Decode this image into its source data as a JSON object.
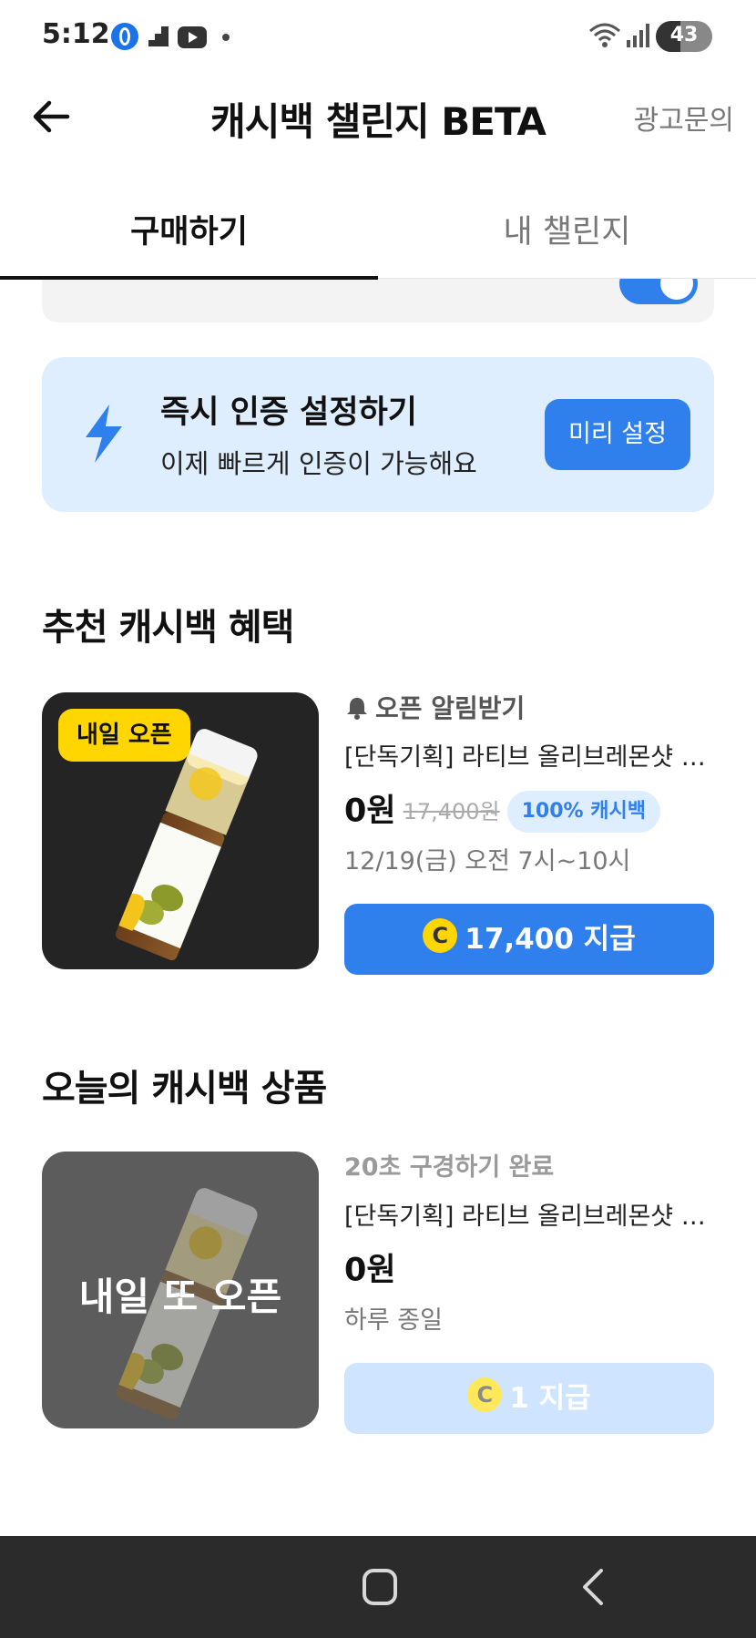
{
  "status_bar": {
    "time": "5:12",
    "battery_level": "43",
    "battery_fraction": 0.43,
    "icons": [
      "opera-icon",
      "stairs-icon",
      "youtube-icon",
      "dot-icon",
      "wifi-icon",
      "signal-icon",
      "battery-icon"
    ]
  },
  "header": {
    "title": "캐시백 챌린지 BETA",
    "action_label": "광고문의"
  },
  "tabs": [
    {
      "label": "구매하기",
      "active": true
    },
    {
      "label": "내 챌린지",
      "active": false
    }
  ],
  "instant_auth": {
    "title": "즉시 인증 설정하기",
    "subtitle": "이제 빠르게 인증이 가능해요",
    "button_label": "미리 설정",
    "icon": "lightning-icon"
  },
  "recommended": {
    "section_title": "추천 캐시백 혜택",
    "item": {
      "badge": "내일 오픈",
      "notify_label": "오픈 알림받기",
      "name": "[단독기획] 라티브 올리브레몬샷 기획세트",
      "price": "0원",
      "original_price": "17,400원",
      "cashback_badge": "100% 캐시백",
      "time": "12/19(금) 오전 7시~10시",
      "coin_symbol": "C",
      "reward_label": "17,400 지급"
    }
  },
  "today": {
    "section_title": "오늘의 캐시백 상품",
    "item": {
      "overlay_label": "내일 또 오픈",
      "status_label": "20초 구경하기 완료",
      "name": "[단독기획] 라티브 올리브레몬샷 기획세트",
      "price": "0원",
      "time": "하루 종일",
      "coin_symbol": "C",
      "reward_label": "1 지급"
    }
  },
  "colors": {
    "accent": "#2f80ed",
    "badge_yellow": "#ffd600",
    "banner_bg": "#dfeeff"
  }
}
